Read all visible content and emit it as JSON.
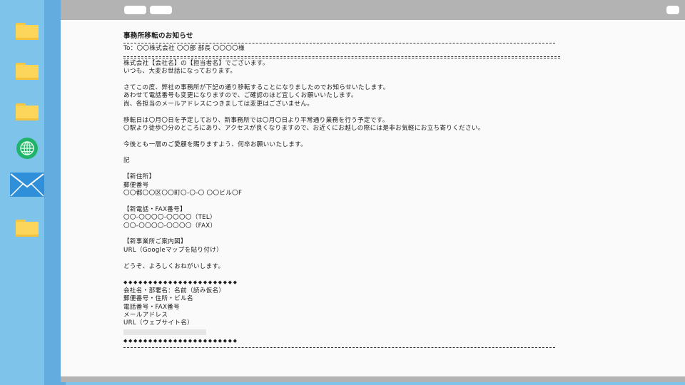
{
  "mail": {
    "title": "事務所移転のお知らせ",
    "to_line": "To：〇〇株式会社 〇〇部 部長 〇〇〇〇様",
    "greeting": [
      "株式会社【会社名】の【担当者名】でございます。",
      "いつも、大変お世話になっております。"
    ],
    "paragraph1": [
      "さてこの度、弊社の事務所が下記の通り移転することになりましたのでお知らせいたします。",
      "あわせて電話番号も変更になりますので、ご確認のほど宜しくお願いいたします。",
      "尚、各担当のメールアドレスにつきましては変更はございません。"
    ],
    "paragraph2": [
      "移転日は〇月〇日を予定しており、新事務所では〇月〇日より平常通り業務を行う予定です。",
      "〇駅より徒歩〇分のところにあり、アクセスが良くなりますので、お近くにお越しの際には是非お気軽にお立ち寄りください。"
    ],
    "closing1": "今後とも一層のご愛顧を賜りますよう、何卒お願いいたします。",
    "ki": "記",
    "address": {
      "heading": "【新住所】",
      "postal": "郵便番号",
      "detail": "〇〇都〇〇区〇〇町〇-〇-〇 〇〇ビル〇F"
    },
    "phone": {
      "heading": "【新電話・FAX番号】",
      "tel": "〇〇-〇〇〇〇-〇〇〇〇（TEL）",
      "fax": "〇〇-〇〇〇〇-〇〇〇〇（FAX）"
    },
    "map": {
      "heading": "【新事業所ご案内図】",
      "url": "URL（Googleマップを貼り付け）"
    },
    "closing2": "どうぞ、よろしくおねがいします。",
    "diamonds": "◆◆◆◆◆◆◆◆◆◆◆◆◆◆◆◆◆◆◆◆◆◆◆",
    "signature": [
      "会社名・部署名：名前（読み仮名）",
      "郵便番号・住所・ビル名",
      "電話番号・FAX番号",
      "メールアドレス",
      "URL（ウェブサイト名）"
    ]
  },
  "colors": {
    "desktop": "#7ec3ea",
    "window_chrome": "#b3b3b3",
    "paper": "#fafafa",
    "folder": "#fbd65a",
    "globe": "#1fb46a",
    "mail_icon": "#2f8fd8"
  },
  "icons": [
    "folder-icon",
    "globe-icon",
    "mail-icon"
  ]
}
